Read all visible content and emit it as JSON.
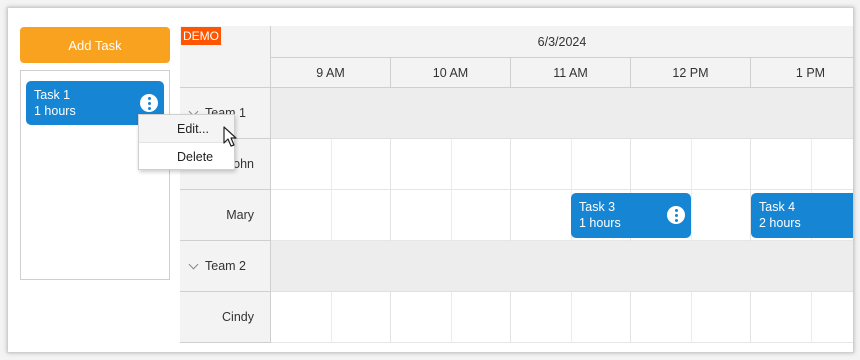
{
  "add_task_label": "Add Task",
  "queue": {
    "items": [
      {
        "name": "Task 1",
        "duration": "1 hours"
      }
    ]
  },
  "scheduler": {
    "badge": "DEMO",
    "day": "6/3/2024",
    "hours": [
      "9 AM",
      "10 AM",
      "11 AM",
      "12 PM",
      "1 PM"
    ],
    "rows": [
      {
        "type": "group",
        "label": "Team 1"
      },
      {
        "type": "resource",
        "label": "John"
      },
      {
        "type": "resource",
        "label": "Mary"
      },
      {
        "type": "group",
        "label": "Team 2"
      },
      {
        "type": "resource",
        "label": "Cindy"
      }
    ],
    "events": [
      {
        "name": "Task 3",
        "duration": "1 hours"
      },
      {
        "name": "Task 4",
        "duration": "2 hours"
      }
    ]
  },
  "context_menu": {
    "items": [
      "Edit...",
      "Delete"
    ]
  },
  "colors": {
    "accent": "#f9a21f",
    "event": "#1685d3",
    "demo_badge": "#ff5500"
  }
}
